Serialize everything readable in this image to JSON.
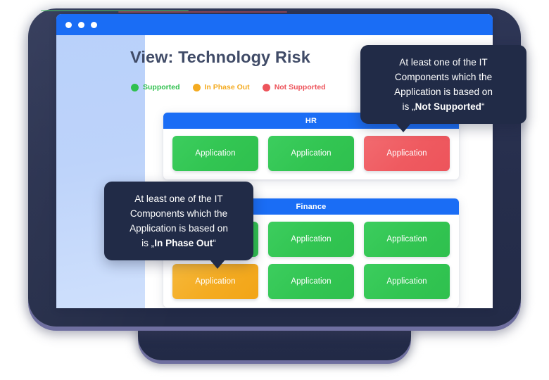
{
  "device": {
    "type": "laptop-illustration"
  },
  "window": {
    "titlebar": {
      "dots": [
        "dot-red",
        "dot-yellow",
        "dot-green"
      ]
    },
    "sidebar": {
      "label": ""
    }
  },
  "page": {
    "title": "View: Technology Risk"
  },
  "legend": {
    "items": [
      {
        "label": "Supported",
        "color": "#2fc04e",
        "text_color": "#2fc04e"
      },
      {
        "label": "In Phase Out",
        "color": "#f4ab21",
        "text_color": "#f4ab21"
      },
      {
        "label": "Not Supported",
        "color": "#ed545b",
        "text_color": "#ed545b"
      }
    ]
  },
  "groups": [
    {
      "name": "HR",
      "rows": [
        [
          {
            "label": "Application",
            "status": "Supported",
            "color": "#32c552"
          },
          {
            "label": "Application",
            "status": "Supported",
            "color": "#32c552"
          },
          {
            "label": "Application",
            "status": "Not Supported",
            "color": "#ef5a60"
          }
        ]
      ]
    },
    {
      "name": "Finance",
      "rows": [
        [
          {
            "label": "Application",
            "status": "Supported",
            "color": "#32c552"
          },
          {
            "label": "Application",
            "status": "Supported",
            "color": "#32c552"
          },
          {
            "label": "Application",
            "status": "Supported",
            "color": "#32c552"
          }
        ],
        [
          {
            "label": "Application",
            "status": "In Phase Out",
            "color": "#f4ab21"
          },
          {
            "label": "Application",
            "status": "Supported",
            "color": "#32c552"
          },
          {
            "label": "Application",
            "status": "Supported",
            "color": "#32c552"
          }
        ]
      ]
    }
  ],
  "tooltips": {
    "not_supported": {
      "line1": "At least one of the IT",
      "line2": "Components which the",
      "line3": "Application is based on",
      "prefix": "is „",
      "emphasis": "Not Supported",
      "suffix": "“"
    },
    "in_phase_out": {
      "line1": "At least one of the IT",
      "line2": "Components which the",
      "line3": "Application is based on",
      "prefix": "is „",
      "emphasis": "In Phase Out",
      "suffix": "“"
    }
  },
  "colors": {
    "brand_blue": "#1a6df5",
    "green": "#32c552",
    "orange": "#f4ab21",
    "red": "#ef5a60",
    "navy": "#212b47",
    "sidebar_blue": "#bdd3fa",
    "title_text": "#404b67"
  }
}
